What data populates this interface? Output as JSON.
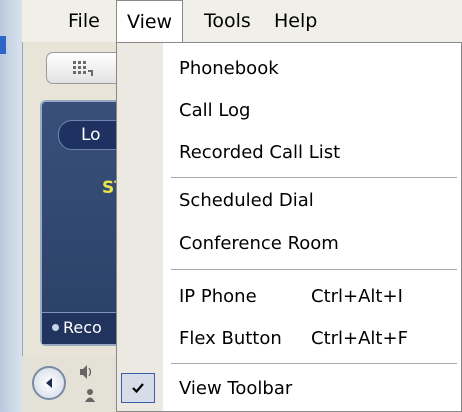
{
  "menubar": {
    "items": [
      "File",
      "View",
      "Tools",
      "Help"
    ],
    "active": "View"
  },
  "app": {
    "login_label": "Lo",
    "status_text": "ST",
    "record_label": "Reco"
  },
  "view_menu": {
    "items": [
      {
        "label": "Phonebook",
        "shortcut": ""
      },
      {
        "label": "Call Log",
        "shortcut": ""
      },
      {
        "label": "Recorded Call List",
        "shortcut": ""
      },
      {
        "label": "Scheduled Dial",
        "shortcut": ""
      },
      {
        "label": "Conference Room",
        "shortcut": ""
      },
      {
        "label": "IP Phone",
        "shortcut": "Ctrl+Alt+I"
      },
      {
        "label": "Flex Button",
        "shortcut": "Ctrl+Alt+F"
      },
      {
        "label": "View Toolbar",
        "shortcut": "",
        "checked": true
      }
    ]
  },
  "icons": {
    "toolbar_button": "dialpad-icon",
    "round_button": "arrow-left-icon",
    "speaker": "speaker-icon",
    "person": "person-icon",
    "check": "check-icon"
  },
  "colors": {
    "panel": "#2f456d",
    "status_text": "#e9e44a",
    "check_border": "#3b5ea8",
    "menu_gutter": "#ebe9e1"
  }
}
